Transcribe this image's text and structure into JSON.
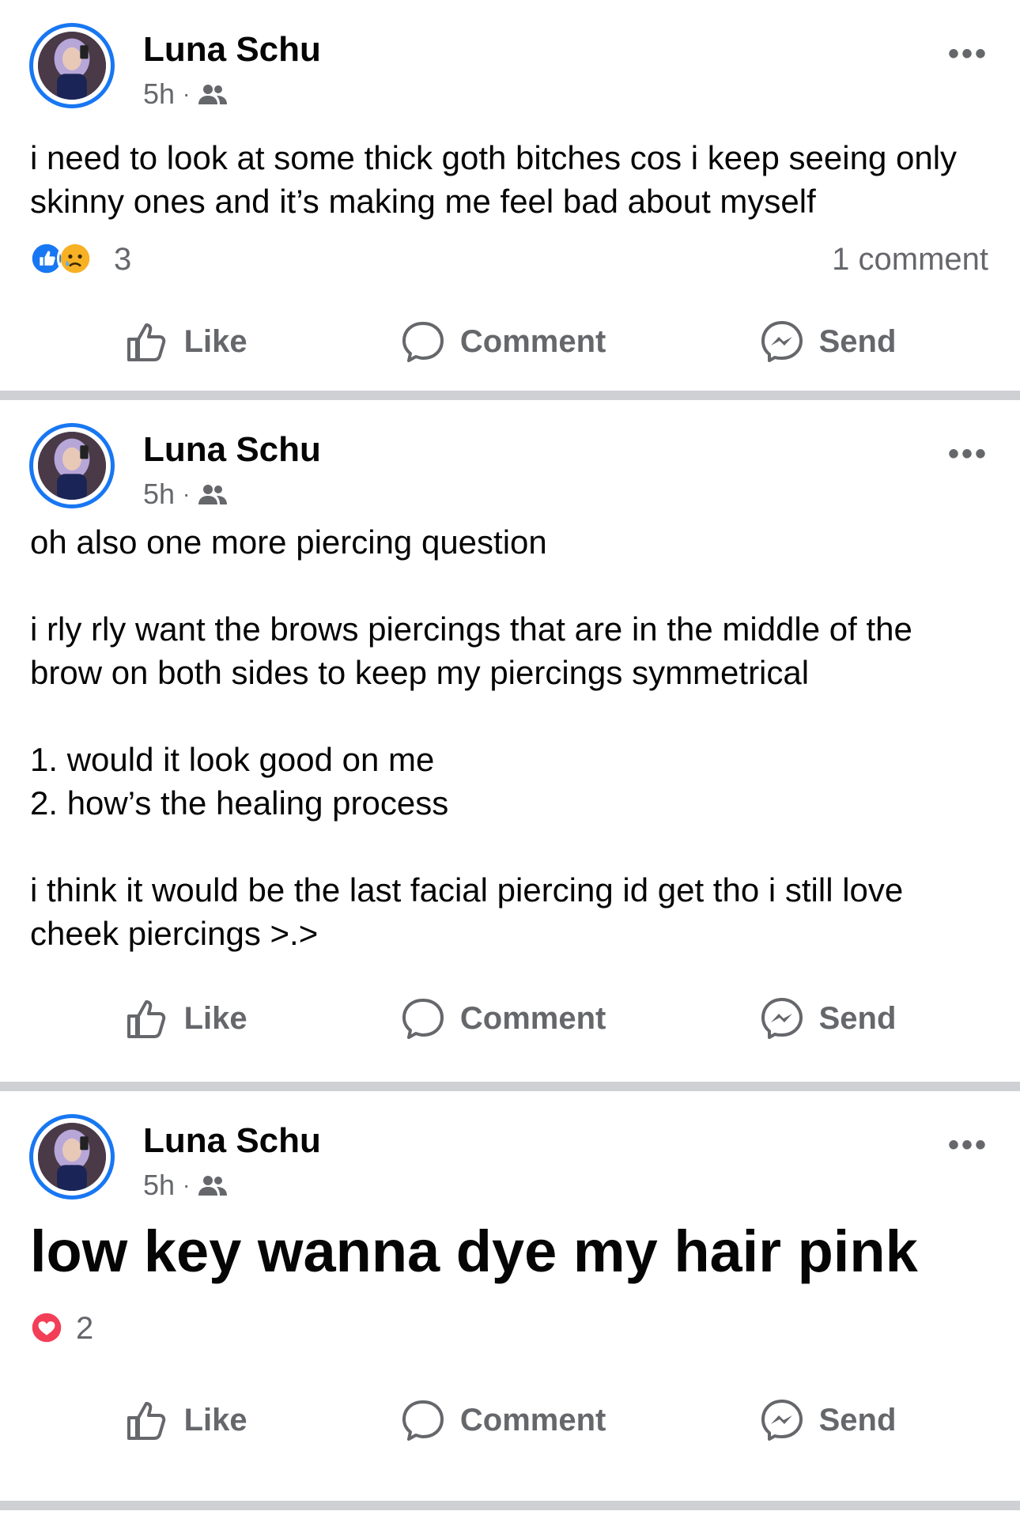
{
  "posts": [
    {
      "author": "Luna Schu",
      "time": "5h",
      "audience_icon": "friends-icon",
      "text": "i need to look at some thick goth bitches cos i keep seeing only skinny ones and it’s making me feel bad about myself",
      "reaction_icons": [
        "like-reaction-icon",
        "sad-reaction-icon"
      ],
      "reaction_count": "3",
      "comment_count": "1 comment"
    },
    {
      "author": "Luna Schu",
      "time": "5h",
      "audience_icon": "friends-icon",
      "text": "oh also one more piercing question\n\ni rly rly want the brows piercings that are in the middle of the brow on both sides to keep my piercings symmetrical\n\n1. would it look good on me\n2. how’s the healing process\n\ni think it would be the last facial piercing id get tho i still love cheek piercings >.>"
    },
    {
      "author": "Luna Schu",
      "time": "5h",
      "audience_icon": "friends-icon",
      "text": "low key wanna dye my hair pink",
      "reaction_icons": [
        "love-reaction-icon"
      ],
      "reaction_count": "2"
    }
  ],
  "actions": {
    "like": "Like",
    "comment": "Comment",
    "send": "Send"
  },
  "colors": {
    "accent": "#1877f2",
    "secondary_text": "#65676b",
    "separator": "#ced0d4",
    "love": "#f33e58",
    "sad": "#f7b125"
  }
}
